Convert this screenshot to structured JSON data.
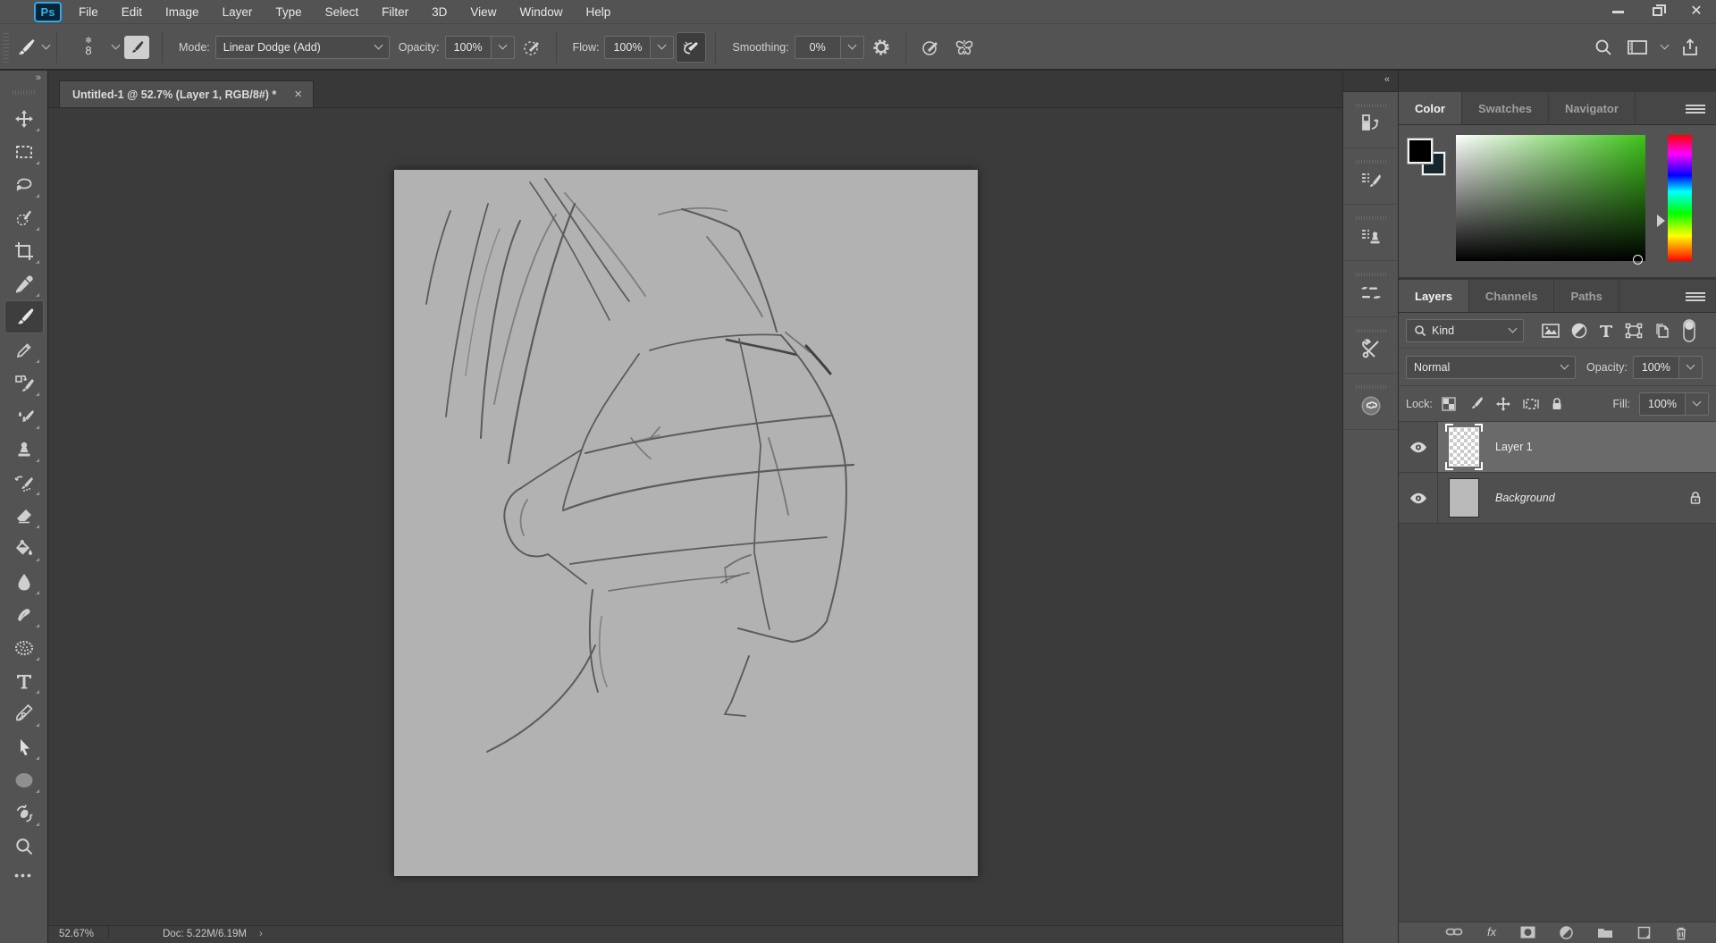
{
  "menubar": {
    "logo": "Ps",
    "items": [
      "File",
      "Edit",
      "Image",
      "Layer",
      "Type",
      "Select",
      "Filter",
      "3D",
      "View",
      "Window",
      "Help"
    ]
  },
  "options_bar": {
    "brush_size": "8",
    "mode": {
      "label": "Mode:",
      "value": "Linear Dodge (Add)"
    },
    "opacity": {
      "label": "Opacity:",
      "value": "100%"
    },
    "flow": {
      "label": "Flow:",
      "value": "100%"
    },
    "smoothing": {
      "label": "Smoothing:",
      "value": "0%"
    }
  },
  "toolbar": {
    "expand_glyph": "»",
    "more_glyph": "•••",
    "tools": [
      "move",
      "rectangular-marquee",
      "lasso",
      "quick-selection",
      "crop",
      "eyedropper",
      "brush",
      "pencil",
      "history-brush",
      "mixer-brush",
      "clone-stamp",
      "art-history-brush",
      "eraser",
      "paint-bucket",
      "blur",
      "smudge",
      "sponge",
      "type",
      "pen",
      "path-selection",
      "ellipse",
      "rotate-view",
      "zoom"
    ],
    "selected_tool": "brush"
  },
  "document": {
    "tab": {
      "title": "Untitled-1 @ 52.7% (Layer 1, RGB/8#) *",
      "close_glyph": "×"
    },
    "status": {
      "zoom": "52.67%",
      "doc": "Doc: 5.22M/6.19M",
      "chevron": "›"
    }
  },
  "dock": {
    "collapse_glyph": "«",
    "icons": [
      "history",
      "brush-settings",
      "clone-source",
      "brushes",
      "tool-presets",
      "creative-cloud"
    ]
  },
  "color_panel": {
    "tabs": [
      "Color",
      "Swatches",
      "Navigator"
    ],
    "active_tab": "Color",
    "foreground_color": "#000000",
    "background_color": "#15262c",
    "field_hue": "#3ec41a"
  },
  "layers_panel": {
    "tabs": [
      "Layers",
      "Channels",
      "Paths"
    ],
    "active_tab": "Layers",
    "kind_value": "Kind",
    "blend_mode": "Normal",
    "opacity_label": "Opacity:",
    "opacity_value": "100%",
    "lock_label": "Lock:",
    "fill_label": "Fill:",
    "fill_value": "100%",
    "fx_label": "fx",
    "rows": [
      {
        "name": "Layer 1",
        "visible": true,
        "selected": true
      },
      {
        "name": "Background",
        "visible": true,
        "locked": true
      }
    ]
  }
}
